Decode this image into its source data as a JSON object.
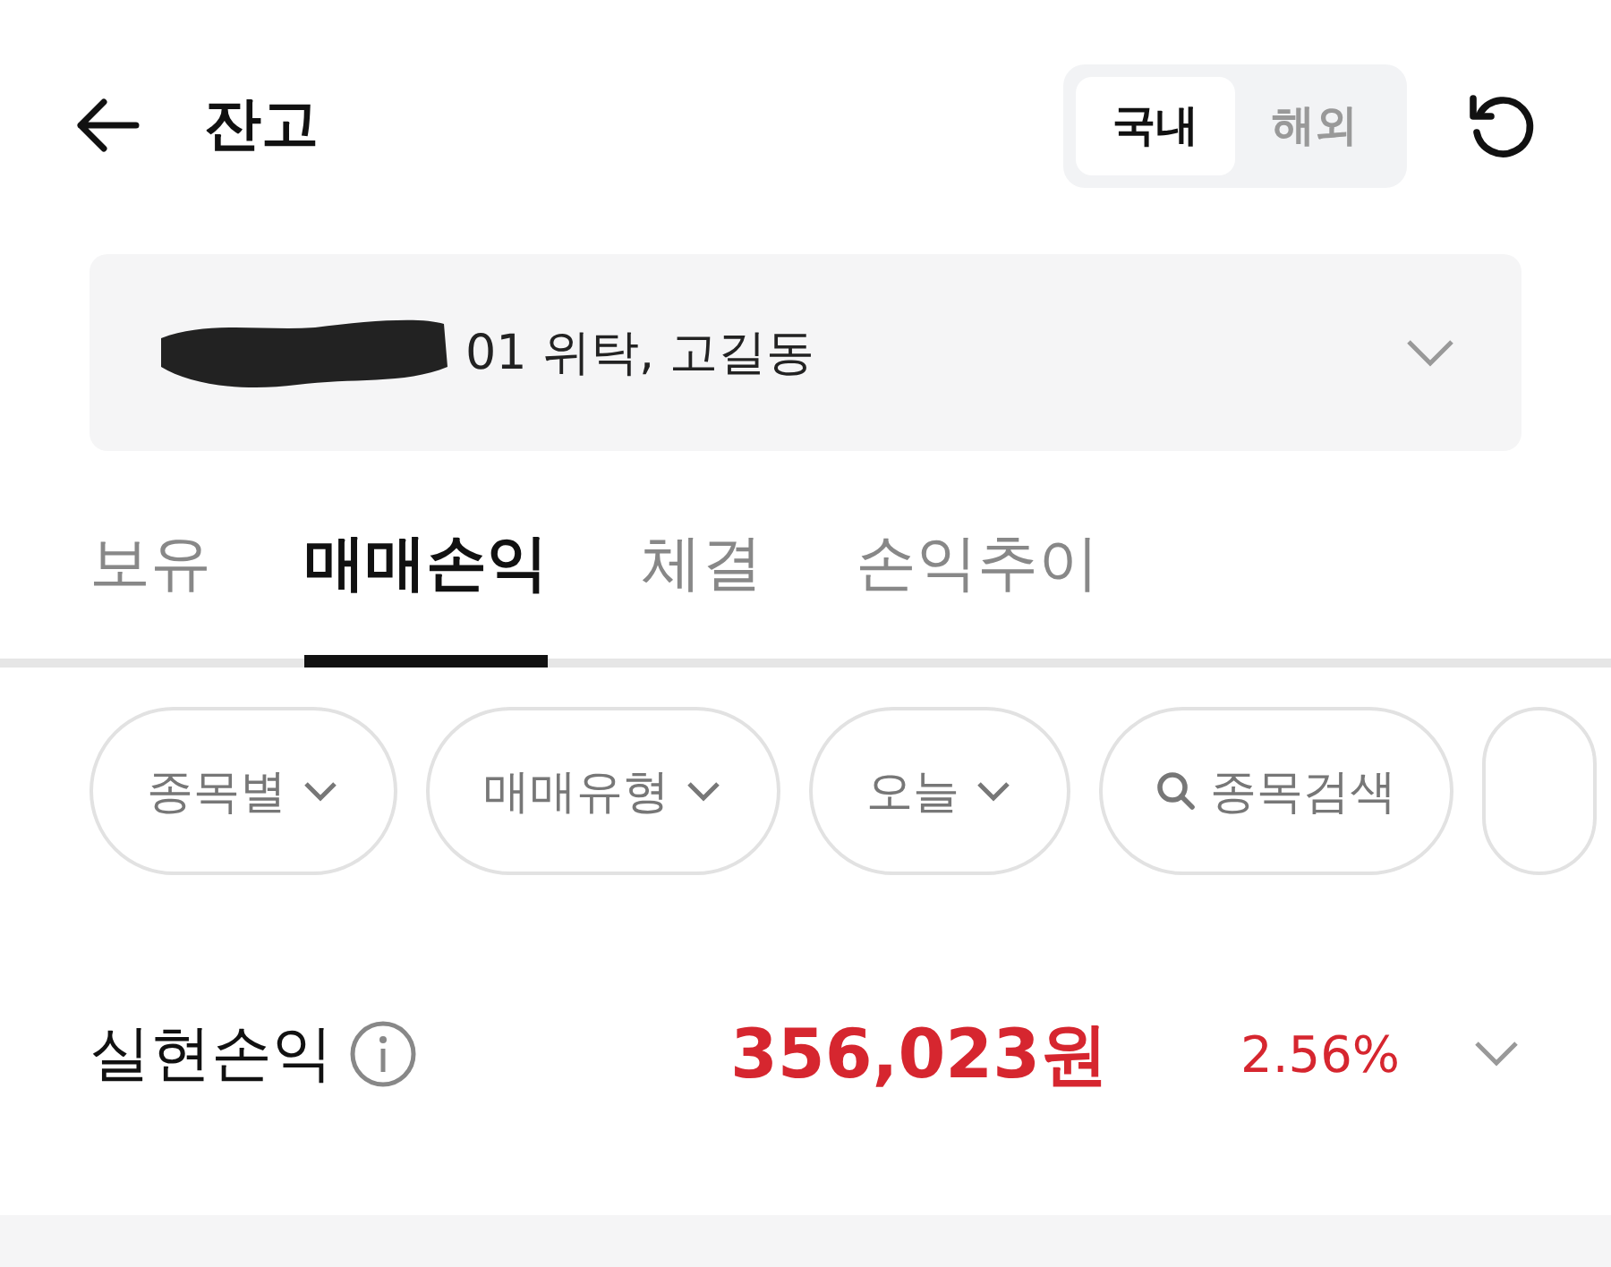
{
  "header": {
    "title": "잔고",
    "segments": [
      {
        "label": "국내",
        "selected": true
      },
      {
        "label": "해외",
        "selected": false
      }
    ]
  },
  "account": {
    "text": "01 위탁, 고길동",
    "redacted": true
  },
  "tabs": [
    {
      "label": "보유",
      "selected": false
    },
    {
      "label": "매매손익",
      "selected": true
    },
    {
      "label": "체결",
      "selected": false
    },
    {
      "label": "손익추이",
      "selected": false
    }
  ],
  "filters": [
    {
      "kind": "dropdown",
      "label": "종목별"
    },
    {
      "kind": "dropdown",
      "label": "매매유형"
    },
    {
      "kind": "dropdown",
      "label": "오늘"
    },
    {
      "kind": "search",
      "label": "종목검색"
    },
    {
      "kind": "more"
    }
  ],
  "summary": {
    "label": "실현손익",
    "amount": "356,023원",
    "rate": "2.56%"
  }
}
